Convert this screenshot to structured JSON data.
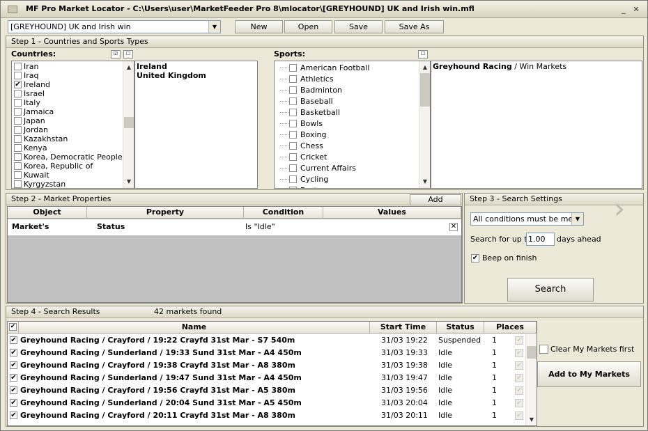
{
  "window": {
    "title": "MF Pro Market Locator - C:\\Users\\user\\MarketFeeder Pro 8\\mlocator\\[GREYHOUND] UK and Irish win.mfl",
    "min": "_",
    "close": "✕"
  },
  "toolbar": {
    "file_select": "[GREYHOUND] UK and Irish win",
    "new": "New",
    "open": "Open",
    "save": "Save",
    "save_as": "Save As"
  },
  "step1": {
    "title": "Step 1 - Countries and Sports Types",
    "countries_label": "Countries:",
    "sports_label": "Sports:",
    "countries": [
      {
        "name": "Iran",
        "checked": false
      },
      {
        "name": "Iraq",
        "checked": false
      },
      {
        "name": "Ireland",
        "checked": true
      },
      {
        "name": "Israel",
        "checked": false
      },
      {
        "name": "Italy",
        "checked": false
      },
      {
        "name": "Jamaica",
        "checked": false
      },
      {
        "name": "Japan",
        "checked": false
      },
      {
        "name": "Jordan",
        "checked": false
      },
      {
        "name": "Kazakhstan",
        "checked": false
      },
      {
        "name": "Kenya",
        "checked": false
      },
      {
        "name": "Korea, Democratic People's Re",
        "checked": false
      },
      {
        "name": "Korea, Republic of",
        "checked": false
      },
      {
        "name": "Kuwait",
        "checked": false
      },
      {
        "name": "Kyrgyzstan",
        "checked": false
      }
    ],
    "selected_countries": [
      "Ireland",
      "United Kingdom"
    ],
    "sports": [
      "American Football",
      "Athletics",
      "Badminton",
      "Baseball",
      "Basketball",
      "Bowls",
      "Boxing",
      "Chess",
      "Cricket",
      "Current Affairs",
      "Cycling",
      "Darts"
    ],
    "selected_sport": "Greyhound Racing",
    "selected_sport_suffix": " / Win Markets"
  },
  "step2": {
    "title": "Step 2 - Market Properties",
    "add": "Add",
    "columns": [
      "Object",
      "Property",
      "Condition",
      "Values"
    ],
    "rows": [
      {
        "object": "Market's",
        "property": "Status",
        "condition": "Is \"Idle\""
      }
    ]
  },
  "step3": {
    "title": "Step 3 - Search Settings",
    "conditions_select": "All conditions must be met",
    "search_for_label": "Search for up to",
    "days_value": "1.00",
    "days_ahead": "days ahead",
    "beep_label": "Beep on finish",
    "search_button": "Search"
  },
  "step4": {
    "title": "Step 4 - Search Results",
    "found": "42 markets found",
    "columns": [
      "Name",
      "Start Time",
      "Status",
      "Places"
    ],
    "rows": [
      {
        "name": "Greyhound Racing / Crayford / 19:22 Crayfd 31st Mar - S7 540m",
        "start": "31/03 19:22",
        "status": "Suspended",
        "places": "1"
      },
      {
        "name": "Greyhound Racing / Sunderland / 19:33 Sund 31st Mar - A4 450m",
        "start": "31/03 19:33",
        "status": "Idle",
        "places": "1"
      },
      {
        "name": "Greyhound Racing / Crayford / 19:38 Crayfd 31st Mar - A8 380m",
        "start": "31/03 19:38",
        "status": "Idle",
        "places": "1"
      },
      {
        "name": "Greyhound Racing / Sunderland / 19:47 Sund 31st Mar - A4 450m",
        "start": "31/03 19:47",
        "status": "Idle",
        "places": "1"
      },
      {
        "name": "Greyhound Racing / Crayford / 19:56 Crayfd 31st Mar - A5 380m",
        "start": "31/03 19:56",
        "status": "Idle",
        "places": "1"
      },
      {
        "name": "Greyhound Racing / Sunderland / 20:04 Sund 31st Mar - A5 450m",
        "start": "31/03 20:04",
        "status": "Idle",
        "places": "1"
      },
      {
        "name": "Greyhound Racing / Crayford / 20:11 Crayfd 31st Mar - A8 380m",
        "start": "31/03 20:11",
        "status": "Idle",
        "places": "1"
      }
    ],
    "clear_label": "Clear My Markets first",
    "add_to_my_markets": "Add to My Markets"
  }
}
